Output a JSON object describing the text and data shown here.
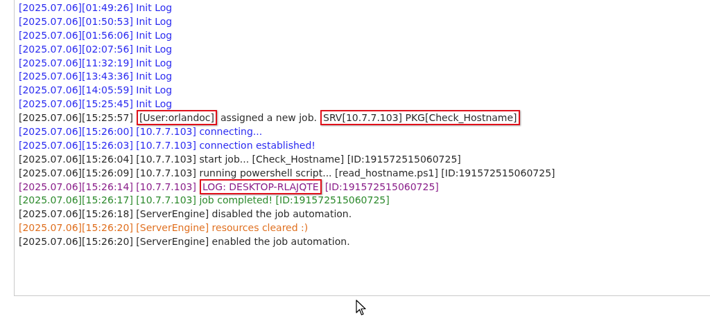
{
  "log": {
    "lines": [
      {
        "kind": "info",
        "segments": [
          {
            "text": "[2025.07.06][01:49:26] Init Log",
            "highlighted": false
          }
        ]
      },
      {
        "kind": "info",
        "segments": [
          {
            "text": "[2025.07.06][01:50:53] Init Log",
            "highlighted": false
          }
        ]
      },
      {
        "kind": "info",
        "segments": [
          {
            "text": "[2025.07.06][01:56:06] Init Log",
            "highlighted": false
          }
        ]
      },
      {
        "kind": "info",
        "segments": [
          {
            "text": "[2025.07.06][02:07:56] Init Log",
            "highlighted": false
          }
        ]
      },
      {
        "kind": "info",
        "segments": [
          {
            "text": "[2025.07.06][11:32:19] Init Log",
            "highlighted": false
          }
        ]
      },
      {
        "kind": "info",
        "segments": [
          {
            "text": "[2025.07.06][13:43:36] Init Log",
            "highlighted": false
          }
        ]
      },
      {
        "kind": "info",
        "segments": [
          {
            "text": "[2025.07.06][14:05:59] Init Log",
            "highlighted": false
          }
        ]
      },
      {
        "kind": "info",
        "segments": [
          {
            "text": "[2025.07.06][15:25:45] Init Log",
            "highlighted": false
          }
        ]
      },
      {
        "kind": "normal",
        "segments": [
          {
            "text": "[2025.07.06][15:25:57]",
            "highlighted": false
          },
          {
            "text": "[User:orlandoc]",
            "highlighted": true
          },
          {
            "text": "assigned a new job.",
            "highlighted": false
          },
          {
            "text": "SRV[10.7.7.103] PKG[Check_Hostname]",
            "highlighted": true
          }
        ]
      },
      {
        "kind": "info",
        "segments": [
          {
            "text": "[2025.07.06][15:26:00] [10.7.7.103] connecting...",
            "highlighted": false
          }
        ]
      },
      {
        "kind": "info",
        "segments": [
          {
            "text": "[2025.07.06][15:26:03] [10.7.7.103] connection established!",
            "highlighted": false
          }
        ]
      },
      {
        "kind": "normal",
        "segments": [
          {
            "text": "[2025.07.06][15:26:04] [10.7.7.103] start job... [Check_Hostname] [ID:191572515060725]",
            "highlighted": false
          }
        ]
      },
      {
        "kind": "normal",
        "segments": [
          {
            "text": "[2025.07.06][15:26:09] [10.7.7.103] running powershell script... [read_hostname.ps1] [ID:191572515060725]",
            "highlighted": false
          }
        ]
      },
      {
        "kind": "output",
        "segments": [
          {
            "text": "[2025.07.06][15:26:14] [10.7.7.103]",
            "highlighted": false
          },
          {
            "text": "LOG: DESKTOP-RLAJQTE",
            "highlighted": true
          },
          {
            "text": "[ID:191572515060725]",
            "highlighted": false
          }
        ]
      },
      {
        "kind": "success",
        "segments": [
          {
            "text": "[2025.07.06][15:26:17] [10.7.7.103] job completed! [ID:191572515060725]",
            "highlighted": false
          }
        ]
      },
      {
        "kind": "normal",
        "segments": [
          {
            "text": "[2025.07.06][15:26:18] [ServerEngine] disabled the job automation.",
            "highlighted": false
          }
        ]
      },
      {
        "kind": "warning",
        "segments": [
          {
            "text": "[2025.07.06][15:26:20] [ServerEngine] resources cleared :)",
            "highlighted": false
          }
        ]
      },
      {
        "kind": "normal",
        "segments": [
          {
            "text": "[2025.07.06][15:26:20] [ServerEngine] enabled the job automation.",
            "highlighted": false
          }
        ]
      }
    ]
  }
}
